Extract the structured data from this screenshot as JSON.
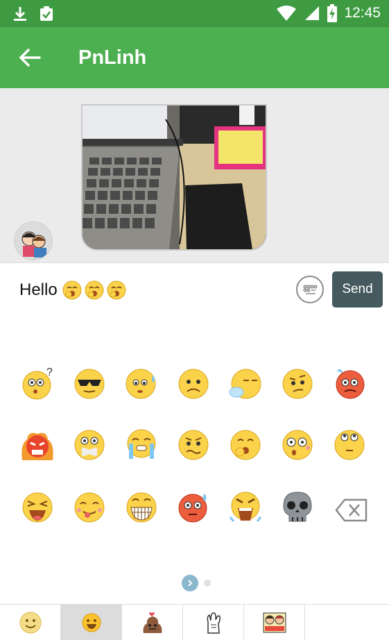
{
  "status_bar": {
    "time": "12:45",
    "icons": [
      "download-icon",
      "clipboard-check-icon",
      "wifi-icon",
      "signal-icon",
      "battery-charging-icon"
    ]
  },
  "app_bar": {
    "title": "PnLinh",
    "back_icon": "arrow-left-icon",
    "color": "#4caf50"
  },
  "composer": {
    "message_text": "Hello",
    "emojis_in_text": 3,
    "send_label": "Send",
    "send_color": "#455a5e"
  },
  "emoji_panel": {
    "rows": [
      [
        "confused-face-icon",
        "sunglasses-face-icon",
        "sweating-face-icon",
        "sad-face-icon",
        "sleepy-face-icon",
        "skeptical-face-icon",
        "angry-red-face-icon"
      ],
      [
        "furious-fire-face-icon",
        "taped-mouth-face-icon",
        "crying-face-icon",
        "worried-face-icon",
        "yawning-face-icon",
        "surprised-face-icon",
        "eye-roll-face-icon"
      ],
      [
        "laughing-face-icon",
        "tongue-face-icon",
        "grinning-face-icon",
        "nervous-red-face-icon",
        "shouting-face-icon",
        "skull-icon",
        "backspace-icon"
      ]
    ],
    "page_count": 2,
    "current_page": 1
  },
  "tabs": [
    {
      "name": "emoji-smile-tab",
      "selected": false
    },
    {
      "name": "emoji-yellow-tab",
      "selected": true
    },
    {
      "name": "sticker-poop-tab",
      "selected": false
    },
    {
      "name": "sticker-hand-tab",
      "selected": false
    },
    {
      "name": "sticker-comic-tab",
      "selected": false
    }
  ]
}
